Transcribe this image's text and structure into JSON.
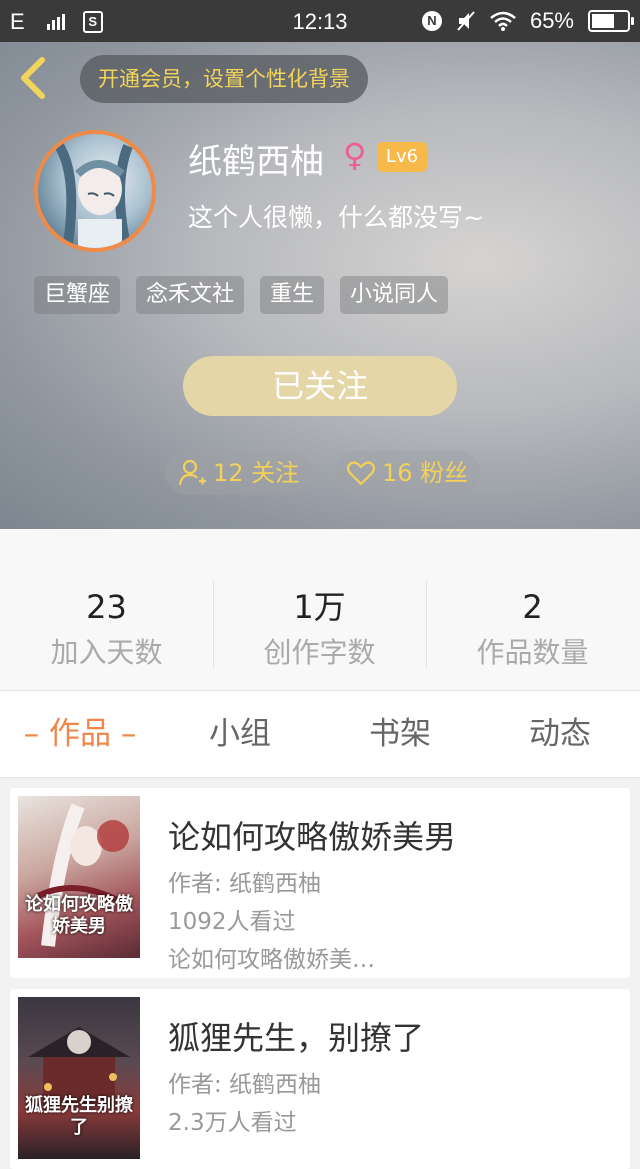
{
  "status_bar": {
    "carrier": "E",
    "sim_label": "S",
    "time": "12:13",
    "n_label": "N",
    "battery": "65%"
  },
  "header": {
    "vip_prompt": "开通会员，设置个性化背景",
    "username": "纸鹤西柚",
    "gender_symbol": "♀",
    "level": "Lv6",
    "bio": "这个人很懒，什么都没写~",
    "tags": [
      "巨蟹座",
      "念禾文社",
      "重生",
      "小说同人"
    ],
    "follow_button": "已关注",
    "following_count": "12 关注",
    "fans_count": "16 粉丝",
    "accent_color": "#f2d05a"
  },
  "stats": [
    {
      "value": "23",
      "label": "加入天数"
    },
    {
      "value": "1万",
      "label": "创作字数"
    },
    {
      "value": "2",
      "label": "作品数量"
    }
  ],
  "tabs": [
    {
      "label": "– 作品 –",
      "active": true
    },
    {
      "label": "小组",
      "active": false
    },
    {
      "label": "书架",
      "active": false
    },
    {
      "label": "动态",
      "active": false
    }
  ],
  "works": [
    {
      "title": "论如何攻略傲娇美男",
      "author": "作者: 纸鹤西柚",
      "views": "1092人看过",
      "desc": "论如何攻略傲娇美…",
      "cover_text": "论如何攻略傲娇美男"
    },
    {
      "title": "狐狸先生，别撩了",
      "author": "作者: 纸鹤西柚",
      "views": "2.3万人看过",
      "desc": "",
      "cover_text": "狐狸先生别撩了"
    }
  ]
}
